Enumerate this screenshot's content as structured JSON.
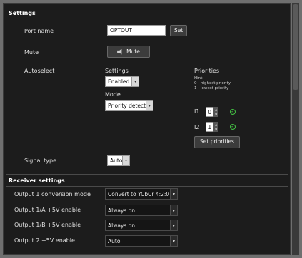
{
  "settings": {
    "title": "Settings",
    "port_name": {
      "label": "Port name",
      "value": "OPTOUT",
      "set_label": "Set"
    },
    "mute": {
      "label": "Mute",
      "button_label": "Mute"
    },
    "autoselect": {
      "label": "Autoselect",
      "settings_label": "Settings",
      "settings_value": "Enabled",
      "mode_label": "Mode",
      "mode_value": "Priority detect",
      "priorities": {
        "title": "Priorities",
        "hint_1": "Hint:",
        "hint_2": "0 - highest priority",
        "hint_3": "1 - lowest priority",
        "inputs": [
          {
            "label": "I1",
            "value": "0"
          },
          {
            "label": "I2",
            "value": "1"
          }
        ],
        "set_label": "Set priorities"
      }
    },
    "signal_type": {
      "label": "Signal type",
      "value": "Auto"
    }
  },
  "receiver": {
    "title": "Receiver settings",
    "rows": [
      {
        "label": "Output 1 conversion mode",
        "value": "Convert to YCbCr 4:2:0"
      },
      {
        "label": "Output 1/A +5V enable",
        "value": "Always on"
      },
      {
        "label": "Output 1/B +5V enable",
        "value": "Always on"
      },
      {
        "label": "Output 2 +5V enable",
        "value": "Auto"
      }
    ]
  }
}
